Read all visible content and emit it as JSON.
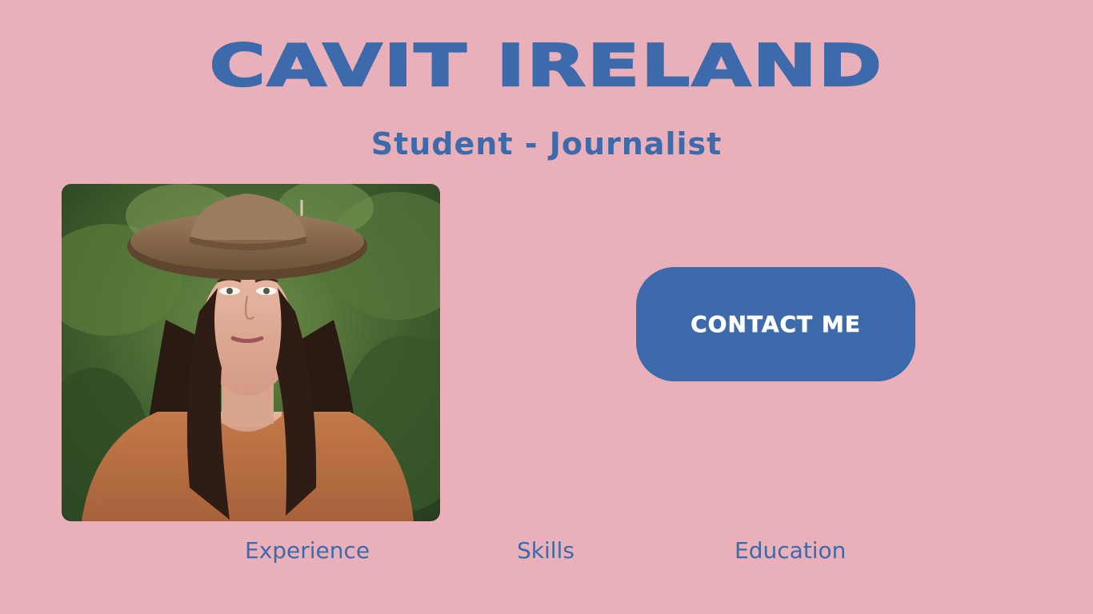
{
  "header": {
    "title": "CAVIT IRELAND",
    "subtitle": "Student - Journalist"
  },
  "profile": {
    "photo_alt": "Portrait photo"
  },
  "cta": {
    "contact_label": "Contact me"
  },
  "nav": {
    "items": [
      {
        "label": "Experience"
      },
      {
        "label": "Skills"
      },
      {
        "label": "Education"
      }
    ]
  },
  "colors": {
    "background": "#e9b0b9",
    "accent": "#3d6aaa",
    "button_text": "#ffffff"
  }
}
